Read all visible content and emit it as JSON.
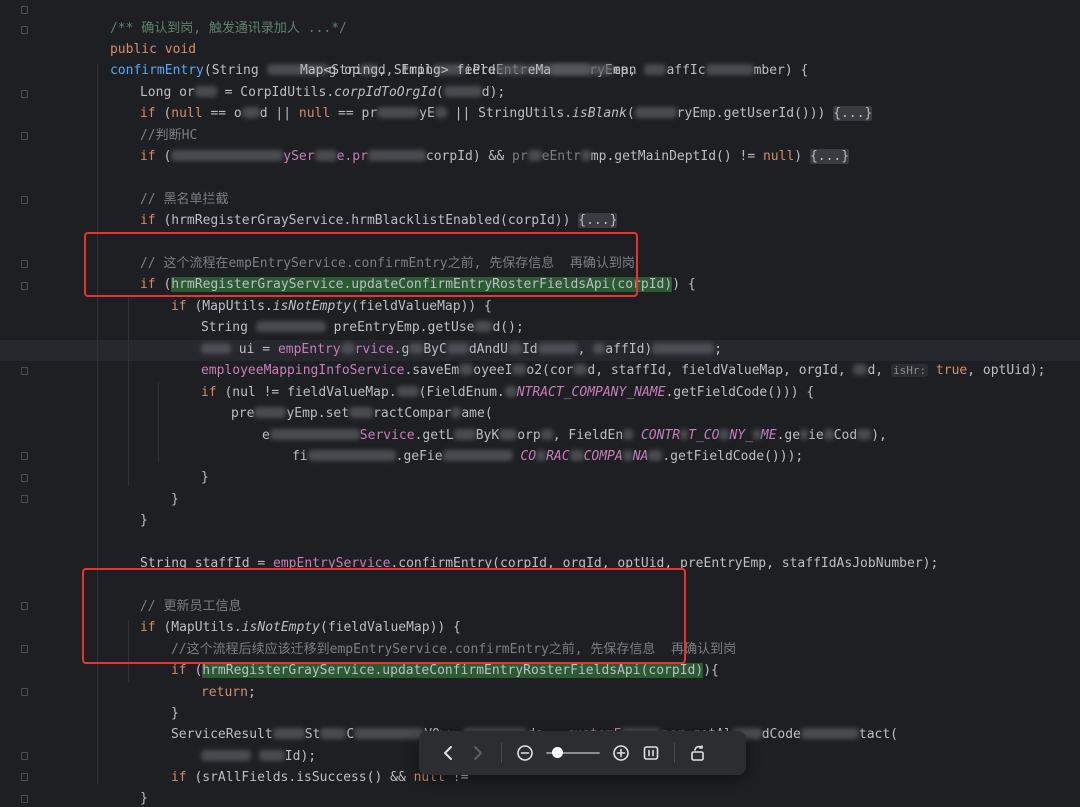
{
  "theme": {
    "background": "#1e1f22",
    "comment": "#7a7e85",
    "keyword": "#cf8e6d",
    "function": "#56a8f5",
    "constant": "#c77dbb",
    "highlight": "#2b5a33",
    "annotation_box": "#e8332f"
  },
  "code": {
    "l1_doc": "/** 确认到岗, 触发通讯录加人 ...*/",
    "l2_public": "public void",
    "l2_method": "confirmEntry",
    "l2_a": "(String ",
    "l2_b": "g op",
    "l2_c": "d, Empl",
    "l2_d": "ePreEntr",
    "l2_e": "ryEmp,",
    "l3_a": "Map<String, String> field",
    "l3_b": "eMa",
    "l3_c": "ean ",
    "l3_d": "affIc",
    "l3_e": "mber) {",
    "l4_a": "Long or",
    "l4_b": " = CorpIdUtils.",
    "l4_c": "corpIdToOrgId",
    "l4_d": "(",
    "l4_e": "d);",
    "l5_if": "if",
    "l5_a": " (",
    "l5_null": "null",
    "l5_b": " == o",
    "l5_c": "d || ",
    "l5_null2": "null",
    "l5_d": " == pr",
    "l5_e": "yE",
    "l5_f": " || StringUtils.",
    "l5_g": "isBlank",
    "l5_h": "(",
    "l5_i": "ryEmp.getUserId()))",
    "l5_fold": "{...}",
    "l6_cmt": "//判断HC",
    "l7_if": "if",
    "l7_a": " (",
    "l7_b": "ySer",
    "l7_c": "e.pr",
    "l7_d": "corpId) && ",
    "l7_e": "pr",
    "l7_f": "eEntr",
    "l7_g": "mp.getMainDeptId() != ",
    "l7_null": "null",
    "l7_h": ") ",
    "l7_fold": "{...}",
    "l9_cmt": "// 黑名单拦截",
    "l10_if": "if",
    "l10_a": " (hrmRegisterGrayService.hrmBlacklistEnabled(corpId)) ",
    "l10_fold": "{...}",
    "l12_cmt": "// 这个流程在empEntryService.confirmEntry之前, 先保存信息  再确认到岗",
    "l13_if": "if",
    "l13_a": " (",
    "l13_hl": "hrmRegisterGrayService.updateConfirmEntryRosterFieldsApi(corpId)",
    "l13_b": ") {",
    "l14_if": "if",
    "l14_a": " (MapUtils.",
    "l14_b": "isNotEmpty",
    "l14_c": "(fieldValueMap)) {",
    "l15_a": "String ",
    "l15_b": " preEntryEmp.getUse",
    "l15_c": "d();",
    "l16_a": " ui",
    "l16_b": " = ",
    "l16_c": "empEntry",
    "l16_d": "rvice",
    "l16_e": ".g",
    "l16_f": "ByC",
    "l16_g": "dAndU",
    "l16_h": "Id",
    "l16_i": ", ",
    "l16_j": "affId)",
    "l16_k": ";",
    "l17_a": "employeeMappingInfoService",
    "l17_b": ".saveEm",
    "l17_c": "oyeeI",
    "l17_d": "o2(cor",
    "l17_e": "d, staffId, fieldValueMap, orgId, ",
    "l17_f": "d, ",
    "l17_inlay": "isHr:",
    "l17_true": " true",
    "l17_g": ", optUid);",
    "l18_if": "if",
    "l18_a": " (nul",
    "l18_b": " != fieldValueMap.",
    "l18_c": "(FieldEnum.",
    "l18_d": "NTRACT_COMPANY_NAME",
    "l18_e": ".getFieldCode())) {",
    "l19_a": "pre",
    "l19_b": "yEmp.set",
    "l19_c": "ractCompar",
    "l19_d": "ame(",
    "l20_a": "e",
    "l20_b": "Service",
    "l20_c": ".getL",
    "l20_d": "ByK",
    "l20_e": "orp",
    "l20_f": ", F",
    "l20_g": "ieldEn",
    "l20_h": " CONTR",
    "l20_i": "T_CO",
    "l20_j": "NY_",
    "l20_k": "ME",
    "l20_l": ".ge",
    "l20_m": "ie",
    "l20_n": "Cod",
    "l20_o": "),",
    "l21_a": "fi",
    "l21_b": ".ge",
    "l21_c": "Fie",
    "l21_d": " CO",
    "l21_e": "RAC",
    "l21_f": "COMPA",
    "l21_g": "NA",
    "l21_h": ".getFieldCode()));",
    "brace_close": "}",
    "l26_a": "String staffId = ",
    "l26_b": "empEntryService",
    "l26_c": ".confirmEntry(corpId, orgId, optUid, preEntryEmp, staffIdAsJobNumber);",
    "l28_cmt": "// 更新员工信息",
    "l29_if": "if",
    "l29_a": " (MapUtils.",
    "l29_b": "isNotEmpty",
    "l29_c": "(fieldValueMap)) {",
    "l30_cmt": "//这个流程后续应该迁移到empEntryService.confirmEntry之前, 先保存信息  再确认到岗",
    "l31_if": "if",
    "l31_a": " (",
    "l31_hl": "hrmRegisterGrayService.updateConfirmEntryRosterFieldsApi(corpId)",
    "l31_b": "){",
    "l32_return": "return",
    "l32_semi": ";",
    "l34_a": "ServiceResult",
    "l34_b": "St",
    "l34_c": "C",
    "l34_d": "VO>> ",
    "l34_e": "ds = ",
    "l34_f": "customF",
    "l34_g": "per",
    "l34_h": ".getAl",
    "l34_i": "dCode",
    "l34_j": "tact(",
    "l35_a": "Id);",
    "l36_if": "if",
    "l36_a": " (srAllFields.isSuccess() && ",
    "l36_null": "null",
    "l36_b": " != "
  },
  "toolbar": {
    "prev_icon": "chevron-left-icon",
    "next_icon": "chevron-right-icon",
    "zoom_out_icon": "zoom-out-icon",
    "zoom_level": 0.15,
    "zoom_in_icon": "zoom-in-icon",
    "fit_icon": "fit-to-screen-icon",
    "rotate_icon": "rotate-icon"
  }
}
